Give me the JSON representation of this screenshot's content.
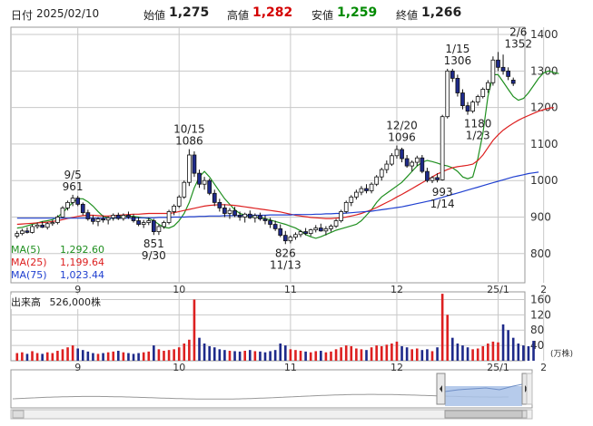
{
  "header": {
    "date_label": "日付",
    "date": "2025/02/10",
    "open_label": "始値",
    "open": "1,275",
    "high_label": "高値",
    "high": "1,282",
    "low_label": "安値",
    "low": "1,259",
    "close_label": "終値",
    "close": "1,266"
  },
  "legend": {
    "ma5_label": "MA(5)",
    "ma5_value": "1,292.60",
    "ma25_label": "MA(25)",
    "ma25_value": "1,199.64",
    "ma75_label": "MA(75)",
    "ma75_value": "1,023.44"
  },
  "volume": {
    "title": "出来高",
    "value": "526,000株",
    "unit": "(万株)"
  },
  "colors": {
    "up": "#ffffff",
    "down": "#1e2a8a",
    "ma5": "#1f8f1f",
    "ma25": "#dd2020",
    "ma75": "#2040d0",
    "vol_up": "#dd2020",
    "vol_down": "#1e2a8a",
    "grid": "#c8c8c8",
    "navigator": "#a9c2e8"
  },
  "chart_data": [
    {
      "type": "candlestick",
      "y_ticks": [
        800,
        900,
        1000,
        1100,
        1200,
        1300,
        1400
      ],
      "ylim": [
        720,
        1420
      ],
      "x_ticks": [
        "9",
        "10",
        "11",
        "12",
        "25/1",
        "2"
      ],
      "annotations": [
        {
          "date": "9/5",
          "value": "961"
        },
        {
          "date": "9/30",
          "value": "851"
        },
        {
          "date": "10/15",
          "value": "1086"
        },
        {
          "date": "11/13",
          "value": "826"
        },
        {
          "date": "12/20",
          "value": "1096"
        },
        {
          "date": "1/14",
          "value": "993"
        },
        {
          "date": "1/15",
          "value": "1306"
        },
        {
          "date": "1/23",
          "value": "1180"
        },
        {
          "date": "2/6",
          "value": "1352"
        }
      ],
      "series": [
        {
          "name": "MA(5)",
          "values": [
            870,
            872,
            876,
            880,
            884,
            888,
            890,
            893,
            900,
            912,
            926,
            940,
            950,
            950,
            942,
            930,
            915,
            902,
            898,
            896,
            900,
            902,
            903,
            902,
            900,
            898,
            896,
            890,
            880,
            872,
            870,
            876,
            890,
            910,
            940,
            980,
            1010,
            1025,
            1010,
            990,
            970,
            950,
            935,
            920,
            910,
            905,
            902,
            900,
            898,
            896,
            892,
            888,
            884,
            880,
            875,
            870,
            862,
            852,
            846,
            842,
            846,
            852,
            858,
            864,
            868,
            872,
            876,
            880,
            890,
            905,
            920,
            940,
            955,
            965,
            975,
            985,
            995,
            1010,
            1025,
            1040,
            1050,
            1055,
            1052,
            1048,
            1043,
            1040,
            1035,
            1025,
            1010,
            1005,
            1010,
            1060,
            1130,
            1230,
            1290,
            1290,
            1270,
            1250,
            1230,
            1220,
            1225,
            1240,
            1260,
            1280,
            1295,
            1300,
            1296,
            1293
          ]
        },
        {
          "name": "MA(25)",
          "values": [
            880,
            881,
            882,
            883,
            884,
            885,
            886,
            888,
            890,
            893,
            896,
            899,
            902,
            904,
            905,
            905,
            904,
            903,
            903,
            904,
            905,
            906,
            907,
            908,
            908,
            909,
            910,
            910,
            910,
            910,
            910,
            912,
            915,
            918,
            921,
            924,
            927,
            930,
            932,
            933,
            934,
            934,
            933,
            932,
            930,
            928,
            926,
            924,
            922,
            920,
            918,
            916,
            914,
            911,
            908,
            905,
            903,
            901,
            899,
            898,
            897,
            896,
            896,
            897,
            898,
            900,
            903,
            906,
            910,
            915,
            920,
            926,
            933,
            940,
            947,
            955,
            962,
            970,
            978,
            986,
            994,
            1002,
            1010,
            1018,
            1024,
            1030,
            1035,
            1038,
            1040,
            1042,
            1045,
            1055,
            1070,
            1090,
            1110,
            1125,
            1138,
            1148,
            1157,
            1165,
            1172,
            1178,
            1184,
            1190,
            1194,
            1198,
            1200
          ]
        },
        {
          "name": "MA(75)",
          "values": [
            897,
            897,
            897,
            897,
            897,
            897,
            897,
            897,
            897,
            897,
            897,
            897,
            897,
            897,
            897,
            897,
            897,
            897,
            897,
            897,
            897,
            897,
            897,
            897,
            898,
            898,
            898,
            898,
            899,
            899,
            899,
            900,
            900,
            900,
            901,
            901,
            902,
            902,
            903,
            903,
            903,
            904,
            904,
            904,
            904,
            905,
            905,
            905,
            905,
            905,
            906,
            906,
            906,
            906,
            906,
            907,
            907,
            907,
            907,
            908,
            908,
            909,
            909,
            910,
            910,
            911,
            912,
            913,
            914,
            915,
            916,
            918,
            920,
            922,
            924,
            926,
            928,
            931,
            934,
            937,
            940,
            943,
            946,
            950,
            954,
            958,
            962,
            966,
            970,
            974,
            978,
            982,
            986,
            990,
            994,
            998,
            1002,
            1006,
            1010,
            1013,
            1016,
            1019,
            1021,
            1023
          ]
        }
      ],
      "candles": [
        [
          848,
          862,
          842,
          855
        ],
        [
          855,
          868,
          850,
          862
        ],
        [
          862,
          872,
          855,
          858
        ],
        [
          858,
          880,
          855,
          874
        ],
        [
          874,
          885,
          868,
          878
        ],
        [
          878,
          888,
          870,
          872
        ],
        [
          872,
          886,
          866,
          882
        ],
        [
          882,
          892,
          876,
          885
        ],
        [
          885,
          905,
          880,
          900
        ],
        [
          900,
          930,
          898,
          925
        ],
        [
          925,
          945,
          918,
          940
        ],
        [
          940,
          961,
          930,
          952
        ],
        [
          952,
          958,
          930,
          935
        ],
        [
          935,
          940,
          905,
          912
        ],
        [
          912,
          920,
          890,
          895
        ],
        [
          895,
          905,
          880,
          888
        ],
        [
          888,
          900,
          875,
          895
        ],
        [
          895,
          905,
          885,
          892
        ],
        [
          892,
          902,
          880,
          898
        ],
        [
          898,
          910,
          890,
          905
        ],
        [
          905,
          912,
          892,
          896
        ],
        [
          896,
          910,
          890,
          905
        ],
        [
          905,
          915,
          895,
          900
        ],
        [
          900,
          908,
          885,
          890
        ],
        [
          890,
          900,
          875,
          880
        ],
        [
          880,
          892,
          870,
          885
        ],
        [
          885,
          898,
          878,
          890
        ],
        [
          890,
          895,
          851,
          860
        ],
        [
          860,
          880,
          851,
          874
        ],
        [
          874,
          890,
          868,
          885
        ],
        [
          885,
          920,
          880,
          915
        ],
        [
          915,
          935,
          905,
          930
        ],
        [
          930,
          960,
          925,
          955
        ],
        [
          955,
          1000,
          950,
          995
        ],
        [
          995,
          1086,
          985,
          1070
        ],
        [
          1070,
          1080,
          1010,
          1020
        ],
        [
          1020,
          1030,
          980,
          990
        ],
        [
          990,
          1010,
          975,
          1000
        ],
        [
          1000,
          1005,
          960,
          965
        ],
        [
          965,
          975,
          930,
          940
        ],
        [
          940,
          950,
          915,
          925
        ],
        [
          925,
          935,
          900,
          910
        ],
        [
          910,
          925,
          895,
          918
        ],
        [
          918,
          928,
          900,
          905
        ],
        [
          905,
          915,
          890,
          900
        ],
        [
          900,
          912,
          885,
          908
        ],
        [
          908,
          918,
          895,
          898
        ],
        [
          898,
          910,
          885,
          904
        ],
        [
          904,
          912,
          890,
          895
        ],
        [
          895,
          905,
          880,
          890
        ],
        [
          890,
          898,
          870,
          880
        ],
        [
          880,
          890,
          862,
          868
        ],
        [
          868,
          880,
          845,
          850
        ],
        [
          850,
          862,
          826,
          835
        ],
        [
          835,
          850,
          828,
          845
        ],
        [
          845,
          858,
          838,
          852
        ],
        [
          852,
          865,
          845,
          860
        ],
        [
          860,
          870,
          850,
          855
        ],
        [
          855,
          868,
          848,
          865
        ],
        [
          865,
          878,
          858,
          870
        ],
        [
          870,
          882,
          860,
          862
        ],
        [
          862,
          875,
          850,
          868
        ],
        [
          868,
          880,
          860,
          875
        ],
        [
          875,
          895,
          870,
          890
        ],
        [
          890,
          920,
          885,
          915
        ],
        [
          915,
          945,
          910,
          940
        ],
        [
          940,
          960,
          930,
          955
        ],
        [
          955,
          975,
          948,
          968
        ],
        [
          968,
          985,
          960,
          978
        ],
        [
          978,
          990,
          965,
          972
        ],
        [
          972,
          995,
          965,
          990
        ],
        [
          990,
          1015,
          985,
          1010
        ],
        [
          1010,
          1035,
          1000,
          1030
        ],
        [
          1030,
          1055,
          1020,
          1045
        ],
        [
          1045,
          1075,
          1040,
          1068
        ],
        [
          1068,
          1096,
          1060,
          1085
        ],
        [
          1085,
          1090,
          1050,
          1060
        ],
        [
          1060,
          1070,
          1035,
          1040
        ],
        [
          1040,
          1055,
          1025,
          1050
        ],
        [
          1050,
          1068,
          1040,
          1062
        ],
        [
          1062,
          1070,
          1020,
          1025
        ],
        [
          1025,
          1035,
          995,
          1000
        ],
        [
          1000,
          1012,
          993,
          1008
        ],
        [
          1008,
          1020,
          995,
          1002
        ],
        [
          1002,
          1180,
          1000,
          1175
        ],
        [
          1175,
          1306,
          1170,
          1300
        ],
        [
          1300,
          1306,
          1270,
          1280
        ],
        [
          1280,
          1290,
          1230,
          1240
        ],
        [
          1240,
          1250,
          1195,
          1205
        ],
        [
          1205,
          1215,
          1180,
          1190
        ],
        [
          1190,
          1220,
          1185,
          1215
        ],
        [
          1215,
          1235,
          1205,
          1230
        ],
        [
          1230,
          1255,
          1225,
          1250
        ],
        [
          1250,
          1275,
          1240,
          1268
        ],
        [
          1268,
          1340,
          1260,
          1330
        ],
        [
          1330,
          1352,
          1300,
          1310
        ],
        [
          1310,
          1345,
          1290,
          1300
        ],
        [
          1300,
          1310,
          1275,
          1285
        ],
        [
          1275,
          1282,
          1259,
          1266
        ]
      ]
    },
    {
      "type": "bar",
      "title": "出来高",
      "y_ticks": [
        40,
        80,
        120,
        160
      ],
      "ylim": [
        0,
        180
      ],
      "values": [
        20,
        22,
        18,
        25,
        20,
        18,
        22,
        20,
        26,
        30,
        35,
        40,
        32,
        28,
        24,
        20,
        18,
        20,
        22,
        24,
        26,
        22,
        20,
        18,
        20,
        22,
        24,
        40,
        30,
        26,
        28,
        30,
        35,
        45,
        55,
        160,
        60,
        45,
        38,
        35,
        30,
        28,
        26,
        25,
        24,
        26,
        28,
        25,
        24,
        22,
        25,
        28,
        45,
        40,
        30,
        28,
        26,
        24,
        22,
        25,
        26,
        22,
        24,
        30,
        35,
        40,
        38,
        32,
        30,
        28,
        35,
        40,
        38,
        42,
        45,
        50,
        38,
        35,
        30,
        32,
        28,
        30,
        25,
        35,
        175,
        120,
        60,
        45,
        40,
        35,
        30,
        32,
        38,
        45,
        50,
        48,
        95,
        80,
        60,
        45,
        40,
        38,
        52
      ],
      "up": [
        1,
        1,
        0,
        1,
        1,
        0,
        1,
        1,
        1,
        1,
        1,
        1,
        0,
        0,
        0,
        0,
        1,
        0,
        1,
        1,
        0,
        1,
        0,
        0,
        0,
        1,
        1,
        0,
        1,
        1,
        1,
        1,
        1,
        1,
        1,
        1,
        0,
        0,
        0,
        0,
        0,
        0,
        1,
        0,
        0,
        1,
        0,
        1,
        0,
        0,
        0,
        0,
        0,
        0,
        1,
        1,
        1,
        0,
        1,
        1,
        0,
        1,
        1,
        1,
        1,
        1,
        1,
        1,
        1,
        0,
        1,
        1,
        1,
        1,
        1,
        1,
        0,
        0,
        1,
        1,
        0,
        0,
        1,
        0,
        1,
        1,
        0,
        0,
        0,
        0,
        1,
        1,
        1,
        1,
        1,
        1,
        0,
        0,
        0,
        0,
        0,
        0,
        0
      ]
    }
  ]
}
